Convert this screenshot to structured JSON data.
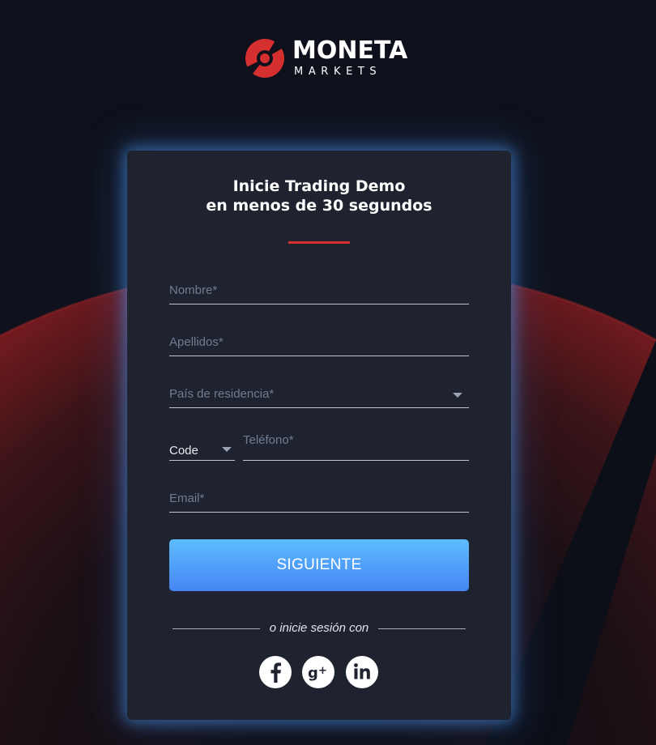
{
  "brand": {
    "name": "MONETA",
    "sub": "MARKETS",
    "logo_color": "#d52f2f"
  },
  "form": {
    "title_line1": "Inicie Trading Demo",
    "title_line2": "en menos de 30 segundos",
    "fields": {
      "nombre_placeholder": "Nombre*",
      "apellidos_placeholder": "Apellidos*",
      "pais_label": "País de residencia*",
      "code_label": "Code",
      "telefono_placeholder": "Teléfono*",
      "email_placeholder": "Email*"
    },
    "submit_label": "SIGUIENTE",
    "alt_login_text": "o inicie sesión con",
    "social": [
      {
        "icon": "facebook-icon"
      },
      {
        "icon": "google-plus-icon"
      },
      {
        "icon": "linkedin-icon"
      }
    ]
  },
  "colors": {
    "background": "#0e111b",
    "card": "#1f2330",
    "accent_red": "#d52f2f",
    "button_blue": "#4f9ef9",
    "glow_blue": "#4e98ee"
  }
}
